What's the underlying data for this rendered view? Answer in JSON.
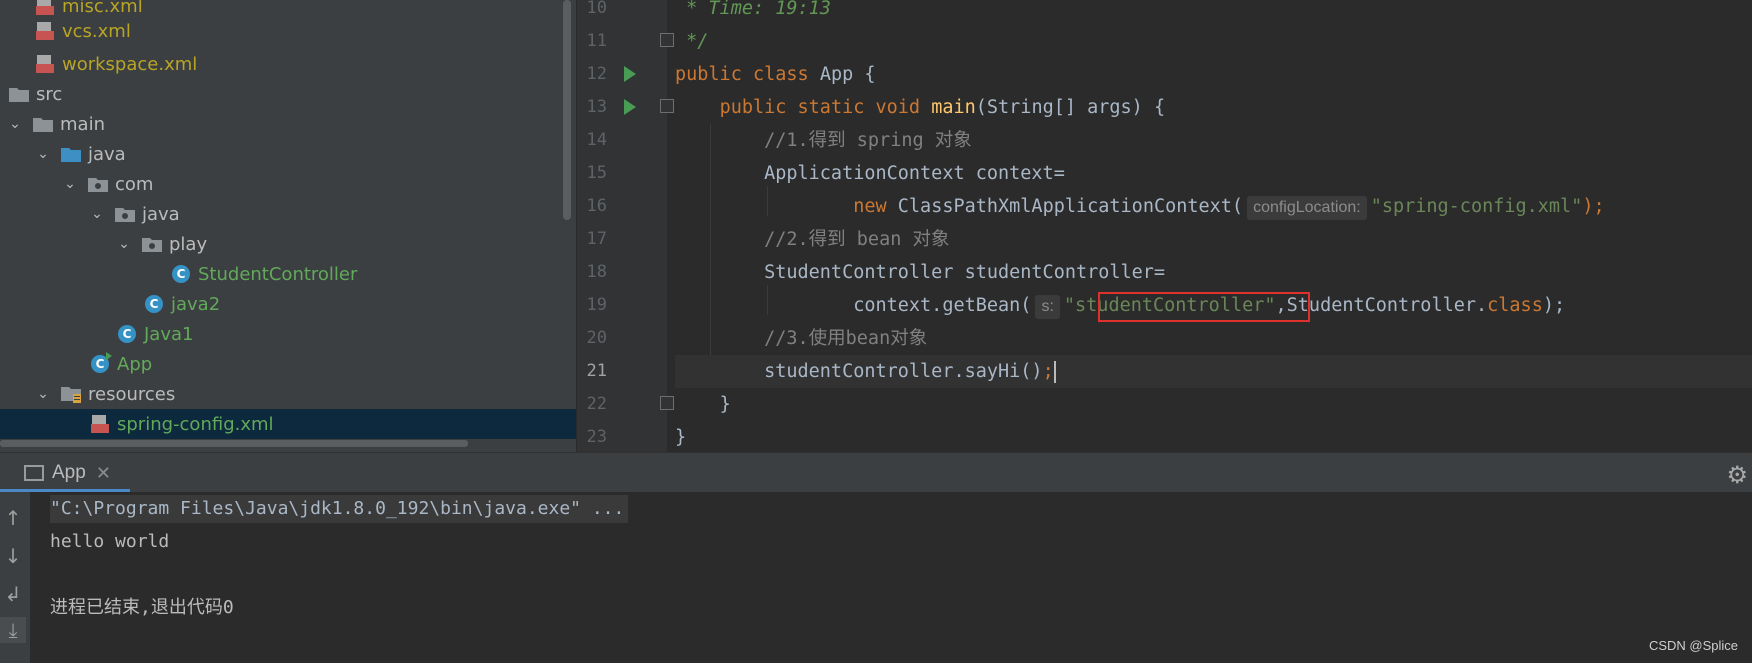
{
  "project_tree": {
    "items": [
      {
        "label": "misc.xml",
        "icon": "xml-file-icon",
        "style": "olive"
      },
      {
        "label": "vcs.xml",
        "icon": "xml-file-icon",
        "style": "olive"
      },
      {
        "label": "workspace.xml",
        "icon": "xml-file-icon",
        "style": "olive"
      },
      {
        "label": "src",
        "icon": "folder-icon",
        "style": "normal"
      },
      {
        "label": "main",
        "icon": "folder-icon",
        "style": "normal",
        "expanded": true
      },
      {
        "label": "java",
        "icon": "source-folder-icon",
        "style": "normal",
        "expanded": true
      },
      {
        "label": "com",
        "icon": "package-icon",
        "style": "normal",
        "expanded": true
      },
      {
        "label": "java",
        "icon": "package-icon",
        "style": "normal",
        "expanded": true
      },
      {
        "label": "play",
        "icon": "package-icon",
        "style": "normal",
        "expanded": true
      },
      {
        "label": "StudentController",
        "icon": "java-class-icon",
        "style": "green"
      },
      {
        "label": "java2",
        "icon": "java-class-icon",
        "style": "green"
      },
      {
        "label": "Java1",
        "icon": "java-class-icon",
        "style": "green"
      },
      {
        "label": "App",
        "icon": "java-main-class-icon",
        "style": "green"
      },
      {
        "label": "resources",
        "icon": "resources-folder-icon",
        "style": "normal",
        "expanded": true
      },
      {
        "label": "spring-config.xml",
        "icon": "xml-file-icon",
        "style": "green",
        "selected": true
      }
    ]
  },
  "editor": {
    "line_numbers": [
      "10",
      "11",
      "12",
      "13",
      "14",
      "15",
      "16",
      "17",
      "18",
      "19",
      "20",
      "21",
      "22",
      "23"
    ],
    "current_line": "21",
    "lines": {
      "l10": " * Time: 19:13",
      "l11": " */",
      "l12_kw1": "public",
      "l12_kw2": "class",
      "l12_name": "App {",
      "l13_kw": "public static void",
      "l13_fn": "main",
      "l13_rest": "(String[] args) {",
      "l14": "//1.得到 spring 对象",
      "l15": "ApplicationContext context=",
      "l16_kw": "new",
      "l16_call": "ClassPathXmlApplicationContext(",
      "l16_hint": "configLocation:",
      "l16_str": "\"spring-config.xml\"",
      "l16_end": ");",
      "l17": "//2.得到 bean 对象",
      "l18": "StudentController studentController=",
      "l19_call": "context.getBean(",
      "l19_hint": "s:",
      "l19_str": "\"studentController\"",
      "l19_mid": ",StudentController.",
      "l19_kw": "class",
      "l19_end": ");",
      "l20": "//3.使用bean对象",
      "l21": "studentController.sayHi()",
      "l21_semi": ";",
      "l22": "}",
      "l23": "}"
    }
  },
  "run_panel": {
    "tab_label": "App",
    "console": [
      "\"C:\\Program Files\\Java\\jdk1.8.0_192\\bin\\java.exe\" ...",
      "hello world",
      "",
      "进程已结束,退出代码0"
    ]
  },
  "watermark": "CSDN @Splice",
  "colors": {
    "keyword": "#cc7832",
    "string": "#6a8759",
    "comment": "#808080",
    "function": "#ffc66d",
    "highlight_box": "#e0302b"
  }
}
